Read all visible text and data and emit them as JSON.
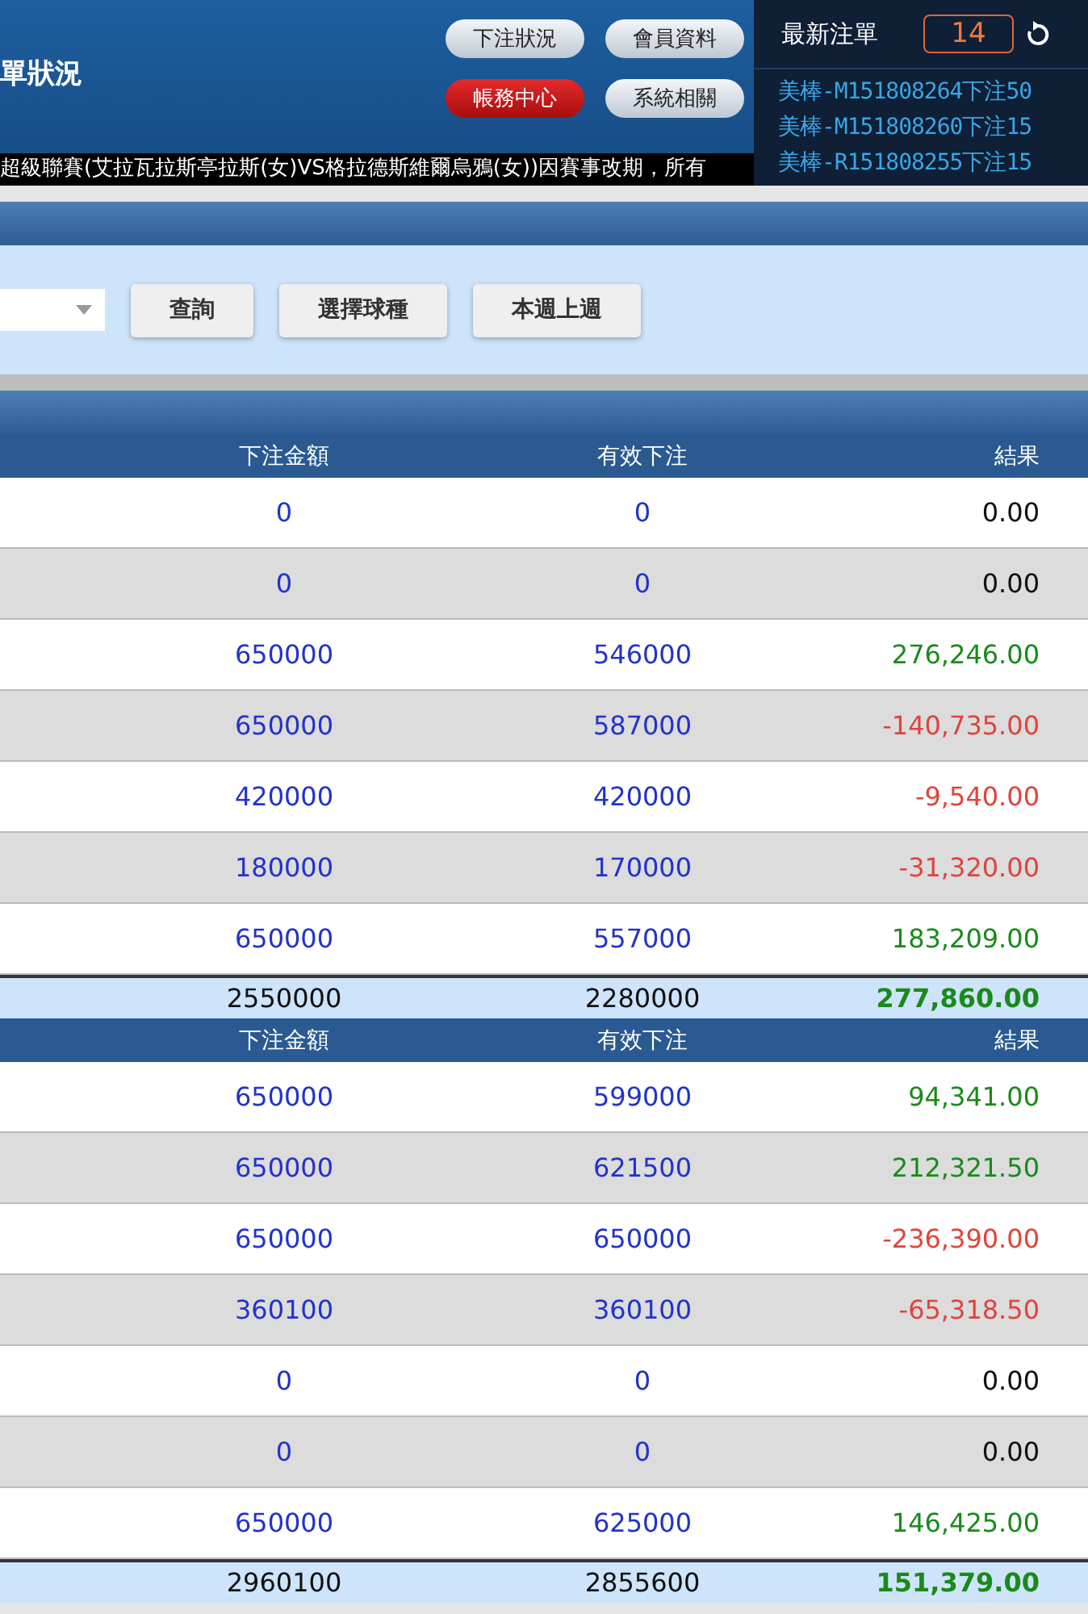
{
  "header": {
    "title": "單狀況",
    "nav_buttons": [
      {
        "label": "下注狀況",
        "selected": false
      },
      {
        "label": "會員資料",
        "selected": false
      },
      {
        "label": "帳務中心",
        "selected": true
      },
      {
        "label": "系統相關",
        "selected": false
      }
    ],
    "ticker": "超級聯賽(艾拉瓦拉斯亭拉斯(女)VS格拉德斯維爾烏鴉(女))因賽事改期，所有"
  },
  "latest_orders": {
    "title": "最新注單",
    "count": "14",
    "items": [
      "美棒-M151808264下注50",
      "美棒-M151808260下注15",
      "美棒-R151808255下注15"
    ]
  },
  "filter": {
    "buttons": [
      "查詢",
      "選擇球種",
      "本週上週"
    ]
  },
  "tables": [
    {
      "columns": [
        "下注金額",
        "有效下注",
        "結果"
      ],
      "rows": [
        {
          "amount": "0",
          "valid": "0",
          "result": "0.00",
          "color": "#111111"
        },
        {
          "amount": "0",
          "valid": "0",
          "result": "0.00",
          "color": "#111111"
        },
        {
          "amount": "650000",
          "valid": "546000",
          "result": "276,246.00",
          "color": "#1a8a1a"
        },
        {
          "amount": "650000",
          "valid": "587000",
          "result": "-140,735.00",
          "color": "#e0443c"
        },
        {
          "amount": "420000",
          "valid": "420000",
          "result": "-9,540.00",
          "color": "#e0443c"
        },
        {
          "amount": "180000",
          "valid": "170000",
          "result": "-31,320.00",
          "color": "#e0443c"
        },
        {
          "amount": "650000",
          "valid": "557000",
          "result": "183,209.00",
          "color": "#1a8a1a"
        }
      ],
      "total": {
        "amount": "2550000",
        "valid": "2280000",
        "result": "277,860.00"
      }
    },
    {
      "columns": [
        "下注金額",
        "有效下注",
        "結果"
      ],
      "rows": [
        {
          "amount": "650000",
          "valid": "599000",
          "result": "94,341.00",
          "color": "#1a8a1a"
        },
        {
          "amount": "650000",
          "valid": "621500",
          "result": "212,321.50",
          "color": "#1a8a1a"
        },
        {
          "amount": "650000",
          "valid": "650000",
          "result": "-236,390.00",
          "color": "#e0443c"
        },
        {
          "amount": "360100",
          "valid": "360100",
          "result": "-65,318.50",
          "color": "#e0443c"
        },
        {
          "amount": "0",
          "valid": "0",
          "result": "0.00",
          "color": "#111111"
        },
        {
          "amount": "0",
          "valid": "0",
          "result": "0.00",
          "color": "#111111"
        },
        {
          "amount": "650000",
          "valid": "625000",
          "result": "146,425.00",
          "color": "#1a8a1a"
        }
      ],
      "total": {
        "amount": "2960100",
        "valid": "2855600",
        "result": "151,379.00"
      }
    }
  ]
}
